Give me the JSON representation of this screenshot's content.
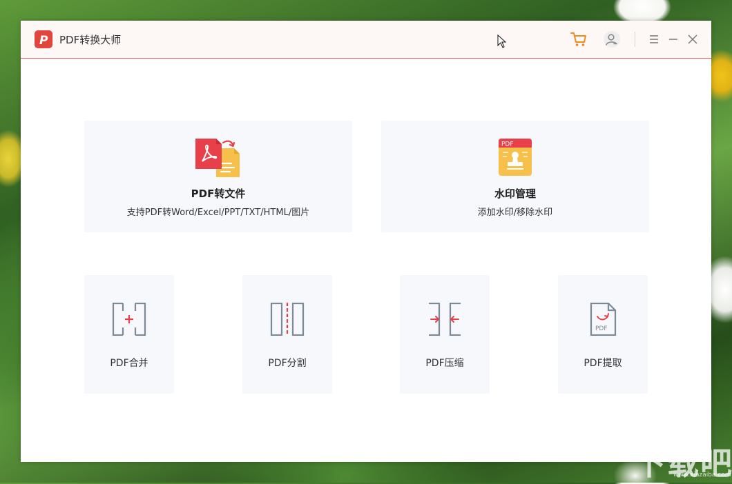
{
  "app": {
    "title": "PDF转换大师",
    "logo_letter": "P",
    "accent_color": "#e2453b",
    "cart_color": "#f08a1c"
  },
  "titlebar": {
    "icons": [
      "cart-icon",
      "user-icon",
      "menu-icon",
      "minimize-icon",
      "close-icon"
    ]
  },
  "features": {
    "convert": {
      "title": "PDF转文件",
      "subtitle": "支持PDF转Word/Excel/PPT/TXT/HTML/图片",
      "icon": "pdf-convert-icon"
    },
    "watermark": {
      "title": "水印管理",
      "subtitle": "添加水印/移除水印",
      "icon": "watermark-stamp-icon",
      "badge": "PDF"
    }
  },
  "tools": [
    {
      "label": "PDF合并",
      "icon": "merge-icon"
    },
    {
      "label": "PDF分割",
      "icon": "split-icon"
    },
    {
      "label": "PDF压缩",
      "icon": "compress-icon"
    },
    {
      "label": "PDF提取",
      "icon": "extract-icon",
      "badge": "PDF"
    }
  ],
  "site_watermark": {
    "text": "下载吧",
    "url": "www.xiazaiba.com"
  }
}
